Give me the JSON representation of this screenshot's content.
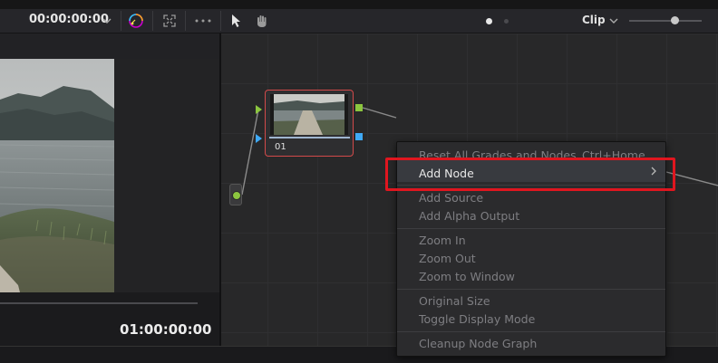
{
  "toolbar": {
    "timecode": "00:00:00:00",
    "timecode_dropdown_icon": "chevron-down",
    "clip_label": "Clip",
    "icons": [
      "color-wheel-icon",
      "fullscreen-icon",
      "more-icon",
      "pointer-icon",
      "hand-icon"
    ]
  },
  "viewer": {
    "timecode": "01:00:00:00"
  },
  "node": {
    "label": "01"
  },
  "context_menu": {
    "items": [
      {
        "label": "Reset All Grades and Nodes",
        "shortcut": "Ctrl+Home",
        "enabled": false
      },
      {
        "label": "Add Node",
        "enabled": true,
        "submenu": true
      },
      {
        "label": "Add Source",
        "enabled": false
      },
      {
        "label": "Add Alpha Output",
        "enabled": false
      },
      {
        "label": "Zoom In",
        "enabled": false
      },
      {
        "label": "Zoom Out",
        "enabled": false
      },
      {
        "label": "Zoom to Window",
        "enabled": false
      },
      {
        "label": "Original Size",
        "enabled": false
      },
      {
        "label": "Toggle Display Mode",
        "enabled": false
      },
      {
        "label": "Cleanup Node Graph",
        "enabled": false
      }
    ]
  },
  "colors": {
    "highlight": "#e0161f",
    "node_border": "#d24a4a",
    "port_green": "#8cc63f",
    "port_blue": "#3fa9f5"
  }
}
